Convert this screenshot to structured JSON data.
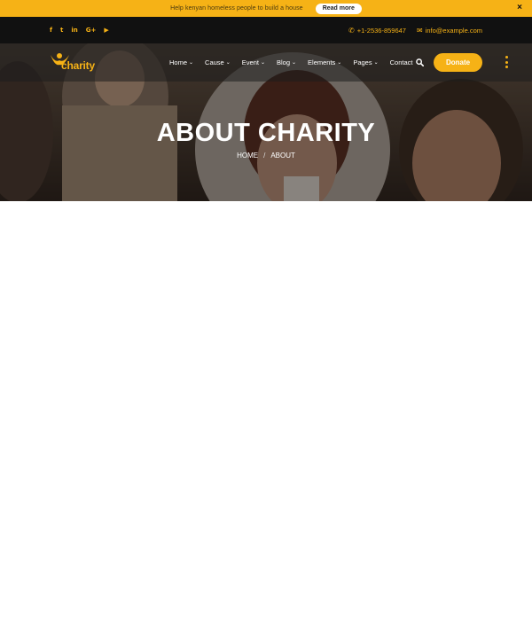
{
  "announcement": {
    "text": "Help kenyan homeless people to build a house",
    "button_label": "Read more",
    "close_glyph": "×"
  },
  "topbar": {
    "social_icons": [
      "facebook-icon",
      "twitter-icon",
      "linkedin-icon",
      "google-plus-icon",
      "youtube-icon"
    ],
    "social_glyphs": [
      "f",
      "t",
      "in",
      "G+",
      "▶"
    ],
    "phone": "+1-2536-859647",
    "email": "info@example.com"
  },
  "navbar": {
    "logo_text": "charity",
    "menu": [
      {
        "label": "Home",
        "dropdown": true
      },
      {
        "label": "Cause",
        "dropdown": true
      },
      {
        "label": "Event",
        "dropdown": true
      },
      {
        "label": "Blog",
        "dropdown": true
      },
      {
        "label": "Elements",
        "dropdown": true
      },
      {
        "label": "Pages",
        "dropdown": true
      },
      {
        "label": "Contact",
        "dropdown": false
      }
    ],
    "donate_label": "Donate"
  },
  "hero": {
    "title": "ABOUT CHARITY",
    "breadcrumb": [
      "HOME",
      "ABOUT"
    ],
    "breadcrumb_separator": "/"
  },
  "colors": {
    "accent": "#f6b216",
    "topbar_bg": "#111111",
    "text_light": "#ffffff"
  }
}
